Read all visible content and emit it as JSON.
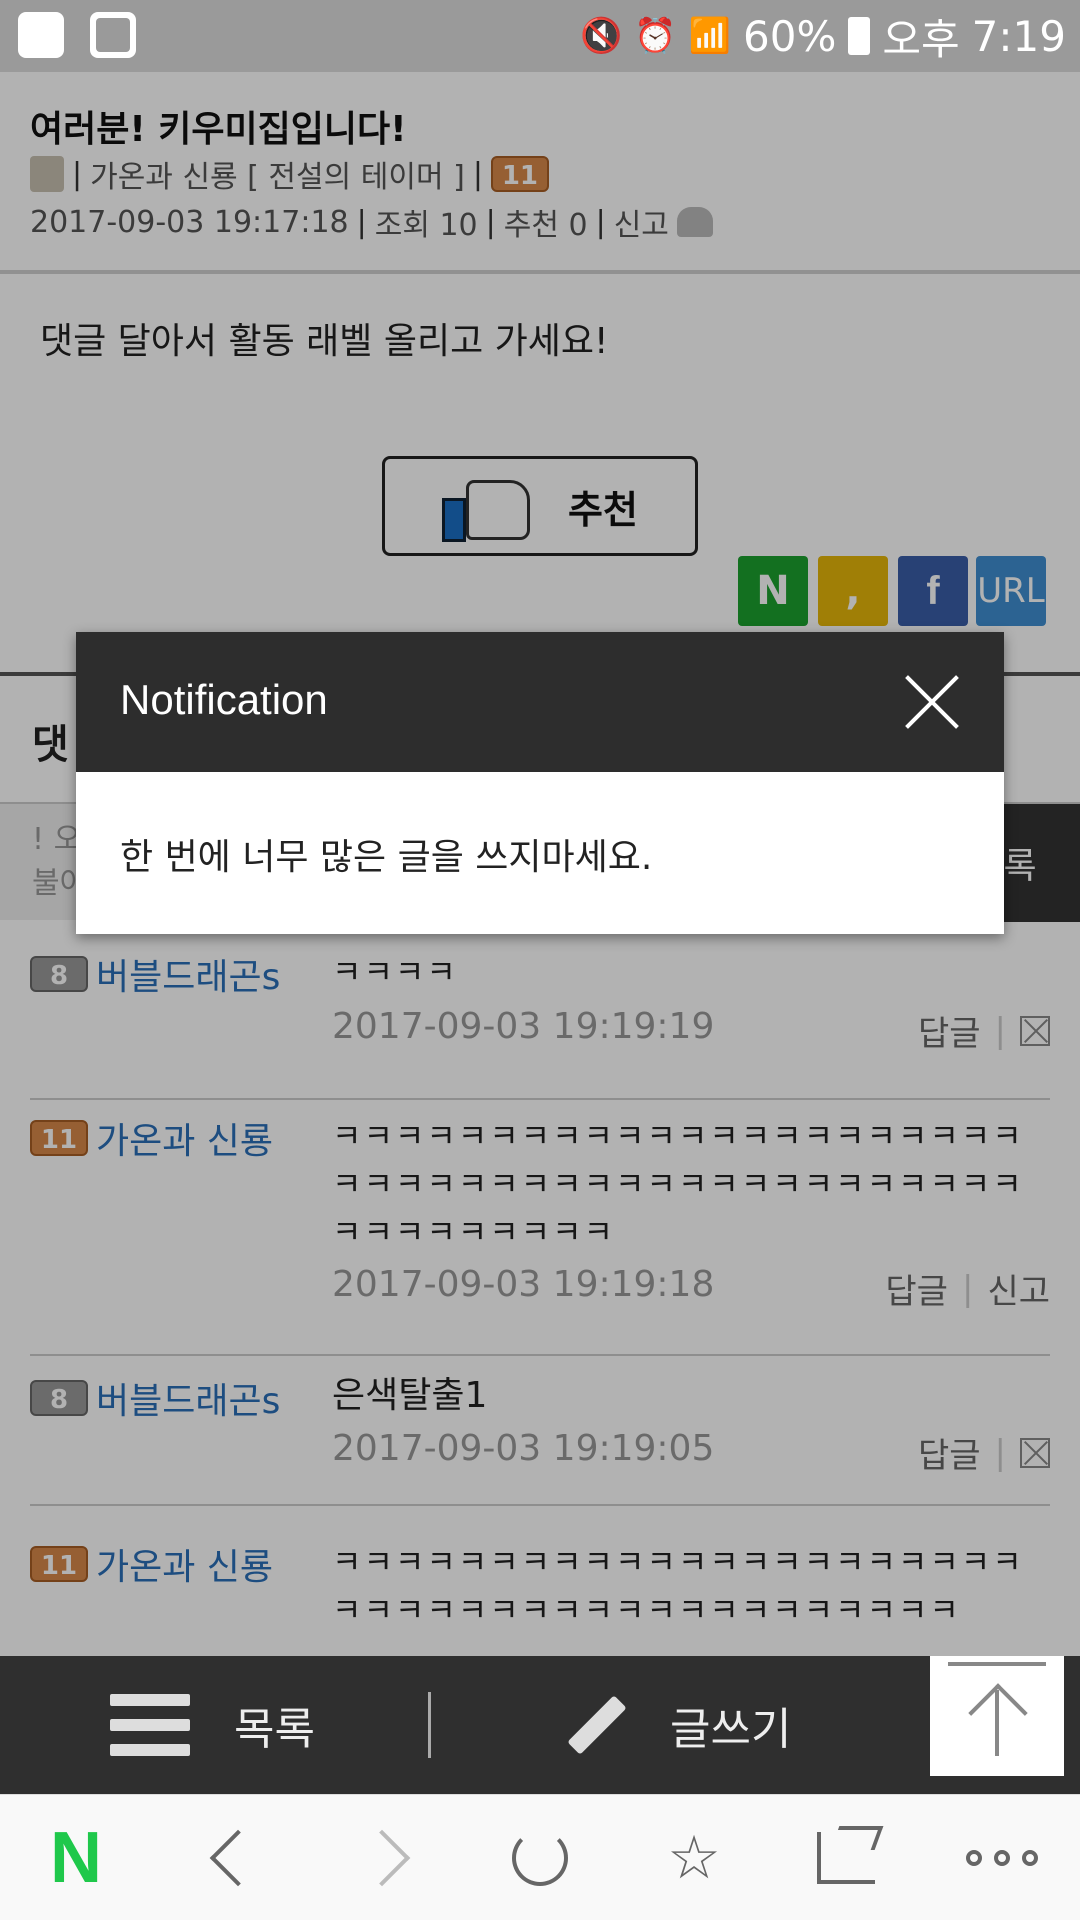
{
  "status_bar": {
    "battery": "60%",
    "ampm": "오후",
    "time": "7:19",
    "icons": [
      "u-plus-icon",
      "gallery-icon",
      "mute-icon",
      "alarm-icon",
      "wifi-icon",
      "signal-icon",
      "battery-icon"
    ]
  },
  "post": {
    "title": "여러분! 키우미집입니다!",
    "author": "가온과 신룡 [ 전설의 테이머 ]",
    "author_level": "11",
    "date": "2017-09-03 19:17:18",
    "views": "조회 10",
    "recommends": "추천 0",
    "report": "신고",
    "body": "댓글 달아서 활동 래벨 올리고 가세요!",
    "recommend_button": "추천"
  },
  "share_buttons": [
    "N",
    ",",
    "f",
    "URL"
  ],
  "share_colors": {
    "naver": "#1ca12f",
    "kakao": "#e5b70a",
    "facebook": "#3a5ea8",
    "url": "#3f8fd1"
  },
  "comments_section": {
    "heading": "댓",
    "input_hint_1": "! 오",
    "input_hint_2": "불아",
    "submit": "록"
  },
  "comments": [
    {
      "level": "8",
      "level_color": "gray",
      "user": "버블드래곤s",
      "text": "ㅋㅋㅋㅋ",
      "date": "2017-09-03 19:19:19",
      "reply": "답글",
      "action": "delete"
    },
    {
      "level": "11",
      "level_color": "orange",
      "user": "가온과 신룡",
      "text": "ㅋㅋㅋㅋㅋㅋㅋㅋㅋㅋㅋㅋㅋㅋㅋㅋㅋㅋㅋㅋㅋㅋㅋㅋㅋㅋㅋㅋㅋㅋㅋㅋㅋㅋㅋㅋㅋㅋㅋㅋㅋㅋㅋㅋㅋㅋㅋㅋㅋㅋㅋㅋㅋ",
      "date": "2017-09-03 19:19:18",
      "reply": "답글",
      "report": "신고"
    },
    {
      "level": "8",
      "level_color": "gray",
      "user": "버블드래곤s",
      "text": "은색탈출1",
      "date": "2017-09-03 19:19:05",
      "reply": "답글",
      "action": "delete"
    },
    {
      "level": "11",
      "level_color": "orange",
      "user": "가온과 신룡",
      "text": "ㅋㅋㅋㅋㅋㅋㅋㅋㅋㅋㅋㅋㅋㅋㅋㅋㅋㅋㅋㅋㅋㅋㅋㅋㅋㅋㅋㅋㅋㅋㅋㅋㅋㅋㅋㅋㅋㅋㅋㅋㅋㅋ"
    }
  ],
  "modal": {
    "title": "Notification",
    "message": "한 번에 너무 많은 글을 쓰지마세요."
  },
  "board_bar": {
    "list_label": "목록",
    "write_label": "글쓰기"
  },
  "browser_nav": {
    "logo": "N"
  }
}
